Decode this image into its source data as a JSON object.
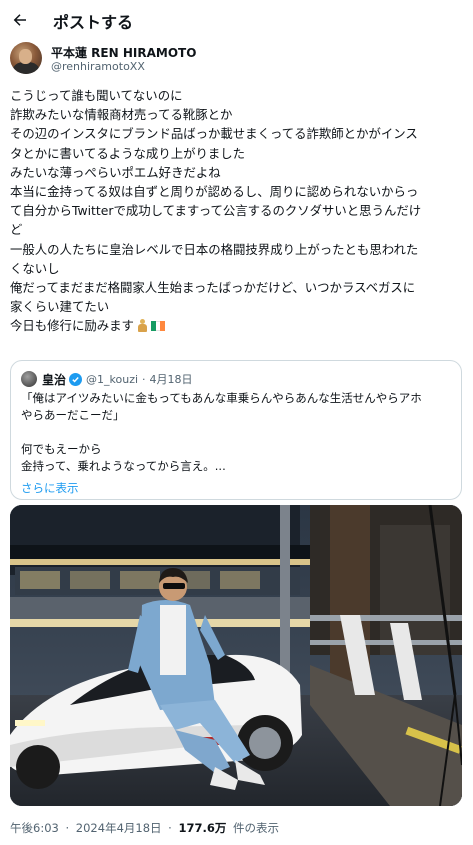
{
  "header": {
    "title": "ポストする",
    "back_icon": "arrow-left-icon"
  },
  "author": {
    "display_name": "平本蓮 REN HIRAMOTO",
    "handle": "@renhiramotoXX"
  },
  "post": {
    "lines": [
      "こうじって誰も聞いてないのに",
      "詐欺みたいな情報商材売ってる靴豚とか",
      "その辺のインスタにブランド品ばっか載せまくってる詐欺師とかがインス",
      "タとかに書いてるような成り上がりました",
      "みたいな薄っぺらいポエム好きだよね",
      "本当に金持ってる奴は自ずと周りが認めるし、周りに認められないからっ",
      "て自分からTwitterで成功してますって公言するのクソダサいと思うんだけ",
      "ど",
      "一般人の人たちに皇治レベルで日本の格闘技界成り上がったとも思われた",
      "くないし",
      "俺だってまだまだ格闘家人生始まったばっかだけど、いつかラスベガスに",
      "家くらい建てたい",
      "今日も修行に励みます"
    ],
    "flag_colors": [
      "#169b62",
      "#ffffff",
      "#ff883e"
    ]
  },
  "quote": {
    "name": "皇治",
    "handle": "@1_kouzi",
    "date": "4月18日",
    "separator": "·",
    "lines": [
      "「俺はアイツみたいに金もってもあんな車乗らんやらあんな生活せんやらアホ",
      "やらあーだこーだ」",
      "",
      "何でもえーから",
      "金持って、乗れようなってから言え。..."
    ],
    "show_more": "さらに表示"
  },
  "photo": {
    "description_icon": "photo-man-on-white-sports-car"
  },
  "footer": {
    "time": "午後6:03",
    "sep": "·",
    "date": "2024年4月18日",
    "views": "177.6万",
    "views_label": "件の表示"
  },
  "colors": {
    "accent": "#1d9bf0",
    "text": "#0f1419",
    "secondary": "#536471",
    "border": "#cfd9de"
  }
}
